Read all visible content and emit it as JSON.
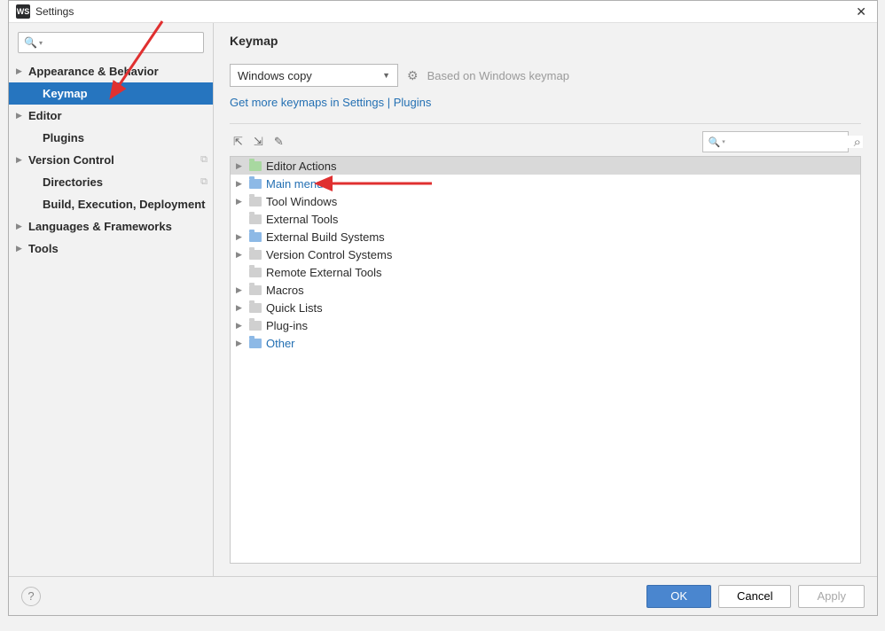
{
  "window": {
    "title": "Settings",
    "app_icon_text": "WS"
  },
  "sidebar": {
    "items": [
      {
        "label": "Appearance & Behavior",
        "expandable": true,
        "child": false
      },
      {
        "label": "Keymap",
        "expandable": false,
        "child": true,
        "selected": true
      },
      {
        "label": "Editor",
        "expandable": true,
        "child": false
      },
      {
        "label": "Plugins",
        "expandable": false,
        "child": true
      },
      {
        "label": "Version Control",
        "expandable": true,
        "child": false,
        "trail": true
      },
      {
        "label": "Directories",
        "expandable": false,
        "child": true,
        "trail": true
      },
      {
        "label": "Build, Execution, Deployment",
        "expandable": false,
        "child": true
      },
      {
        "label": "Languages & Frameworks",
        "expandable": true,
        "child": false
      },
      {
        "label": "Tools",
        "expandable": true,
        "child": false
      }
    ]
  },
  "main": {
    "title": "Keymap",
    "scheme": "Windows copy",
    "based_on": "Based on Windows keymap",
    "more_link": "Get more keymaps in Settings | Plugins",
    "actions": [
      {
        "label": "Editor Actions",
        "arrow": true,
        "icon": "green",
        "link": false,
        "sel": true
      },
      {
        "label": "Main menu",
        "arrow": true,
        "icon": "blue",
        "link": true
      },
      {
        "label": "Tool Windows",
        "arrow": true,
        "icon": "gray",
        "link": false
      },
      {
        "label": "External Tools",
        "arrow": false,
        "icon": "gray",
        "link": false
      },
      {
        "label": "External Build Systems",
        "arrow": true,
        "icon": "blue",
        "link": false
      },
      {
        "label": "Version Control Systems",
        "arrow": true,
        "icon": "gray",
        "link": false
      },
      {
        "label": "Remote External Tools",
        "arrow": false,
        "icon": "gray",
        "link": false
      },
      {
        "label": "Macros",
        "arrow": true,
        "icon": "gray",
        "link": false
      },
      {
        "label": "Quick Lists",
        "arrow": true,
        "icon": "gray",
        "link": false
      },
      {
        "label": "Plug-ins",
        "arrow": true,
        "icon": "gray",
        "link": false
      },
      {
        "label": "Other",
        "arrow": true,
        "icon": "blue",
        "link": true
      }
    ]
  },
  "footer": {
    "ok": "OK",
    "cancel": "Cancel",
    "apply": "Apply"
  }
}
